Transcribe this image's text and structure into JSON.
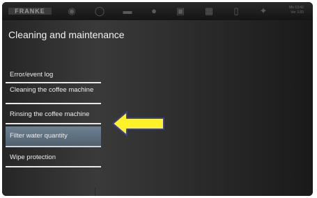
{
  "topbar": {
    "logo": "FRANKE",
    "icons": [
      "bean-icon",
      "cup-icon",
      "recipe-icon",
      "drop-icon",
      "tray-icon",
      "chart-icon",
      "document-icon",
      "wrench-icon"
    ],
    "info_lines": [
      "Mo 13:42",
      "Ver 3.89"
    ]
  },
  "page": {
    "title": "Cleaning and maintenance"
  },
  "menu": {
    "items": [
      {
        "label": "Error/event log"
      },
      {
        "label": "Cleaning the coffee machine"
      },
      {
        "label": "Rinsing the coffee machine"
      },
      {
        "label": "Filter water quantity"
      },
      {
        "label": "Wipe protection"
      }
    ]
  },
  "colors": {
    "selected_item": "#5e6f80",
    "arrow_fill": "#fff22a",
    "arrow_stroke": "#3a3f8f"
  }
}
